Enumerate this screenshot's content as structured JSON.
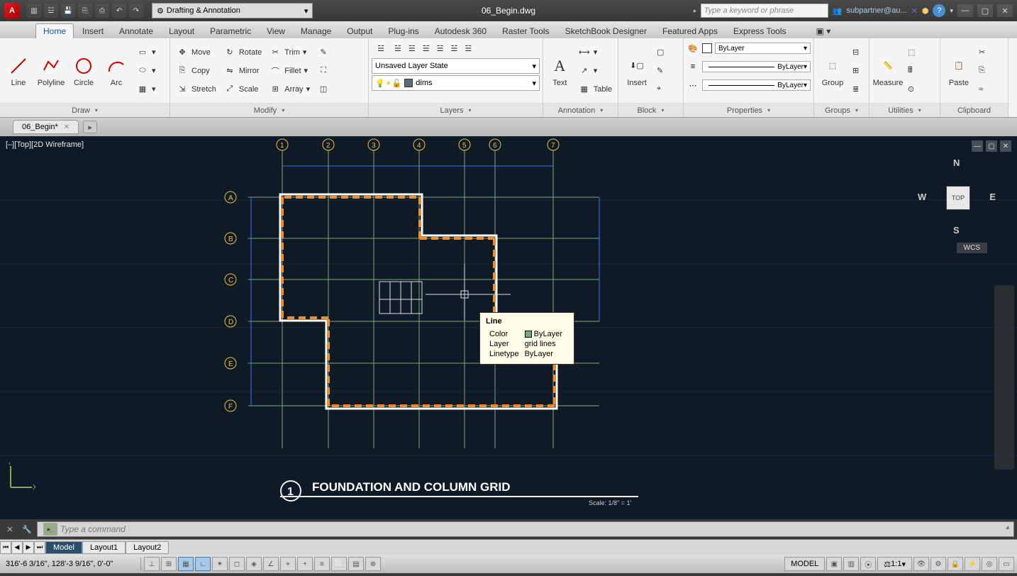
{
  "title": "06_Begin.dwg",
  "workspace": "Drafting & Annotation",
  "search_placeholder": "Type a keyword or phrase",
  "user": "subpartner@au...",
  "ribbon_tabs": [
    "Home",
    "Insert",
    "Annotate",
    "Layout",
    "Parametric",
    "View",
    "Manage",
    "Output",
    "Plug-ins",
    "Autodesk 360",
    "Raster Tools",
    "SketchBook Designer",
    "Featured Apps",
    "Express Tools"
  ],
  "active_tab": 0,
  "ribbon": {
    "draw": {
      "title": "Draw",
      "line": "Line",
      "polyline": "Polyline",
      "circle": "Circle",
      "arc": "Arc"
    },
    "modify": {
      "title": "Modify",
      "move": "Move",
      "rotate": "Rotate",
      "trim": "Trim",
      "copy": "Copy",
      "mirror": "Mirror",
      "fillet": "Fillet",
      "stretch": "Stretch",
      "scale": "Scale",
      "array": "Array"
    },
    "layers": {
      "title": "Layers",
      "state": "Unsaved Layer State",
      "current": "dims"
    },
    "annotation": {
      "title": "Annotation",
      "text": "Text",
      "table": "Table"
    },
    "block": {
      "title": "Block",
      "insert": "Insert"
    },
    "properties": {
      "title": "Properties",
      "color": "ByLayer",
      "lw": "ByLayer",
      "lt": "ByLayer"
    },
    "groups": {
      "title": "Groups",
      "group": "Group"
    },
    "utilities": {
      "title": "Utilities",
      "measure": "Measure"
    },
    "clipboard": {
      "title": "Clipboard",
      "paste": "Paste"
    }
  },
  "file_tab": "06_Begin*",
  "viewport_label": "[–][Top][2D Wireframe]",
  "drawing": {
    "col_labels": [
      "1",
      "2",
      "3",
      "4",
      "5",
      "6",
      "7"
    ],
    "row_labels": [
      "A",
      "B",
      "C",
      "D",
      "E",
      "F"
    ],
    "title_num": "1",
    "title_text": "FOUNDATION AND COLUMN GRID",
    "scale": "Scale: 1/8\" = 1'"
  },
  "tooltip": {
    "heading": "Line",
    "rows": [
      {
        "k": "Color",
        "v": "ByLayer",
        "swatch": "#7da87d"
      },
      {
        "k": "Layer",
        "v": "grid lines"
      },
      {
        "k": "Linetype",
        "v": "ByLayer"
      }
    ]
  },
  "viewcube": {
    "n": "N",
    "s": "S",
    "e": "E",
    "w": "W",
    "top": "TOP",
    "wcs": "WCS"
  },
  "cmd_placeholder": "Type a command",
  "layout_tabs": [
    "Model",
    "Layout1",
    "Layout2"
  ],
  "coords": "316'-6 3/16\", 128'-3 9/16\", 0'-0\"",
  "status_right": {
    "model": "MODEL",
    "scale": "1:1"
  }
}
